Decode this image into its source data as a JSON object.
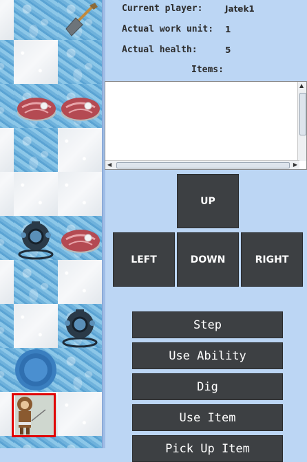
{
  "status": {
    "current_player_label": "Current player:",
    "current_player_value": "Jatek1",
    "work_unit_label": "Actual work unit:",
    "work_unit_value": "1",
    "health_label": "Actual health:",
    "health_value": "5",
    "items_label": "Items:"
  },
  "directions": {
    "up": "UP",
    "left": "LEFT",
    "down": "DOWN",
    "right": "RIGHT"
  },
  "actions": {
    "step": "Step",
    "use_ability": "Use Ability",
    "dig": "Dig",
    "use_item": "Use Item",
    "pick_up_item": "Pick Up Item"
  },
  "board_items": [
    "shovel-icon",
    "meat-icon",
    "diving-suit-icon",
    "hole-icon",
    "eskimo-icon"
  ],
  "colors": {
    "panel_bg": "#bcd6f4",
    "button_bg": "#3d4043",
    "button_text": "#ffffff",
    "selection": "#e00000"
  }
}
